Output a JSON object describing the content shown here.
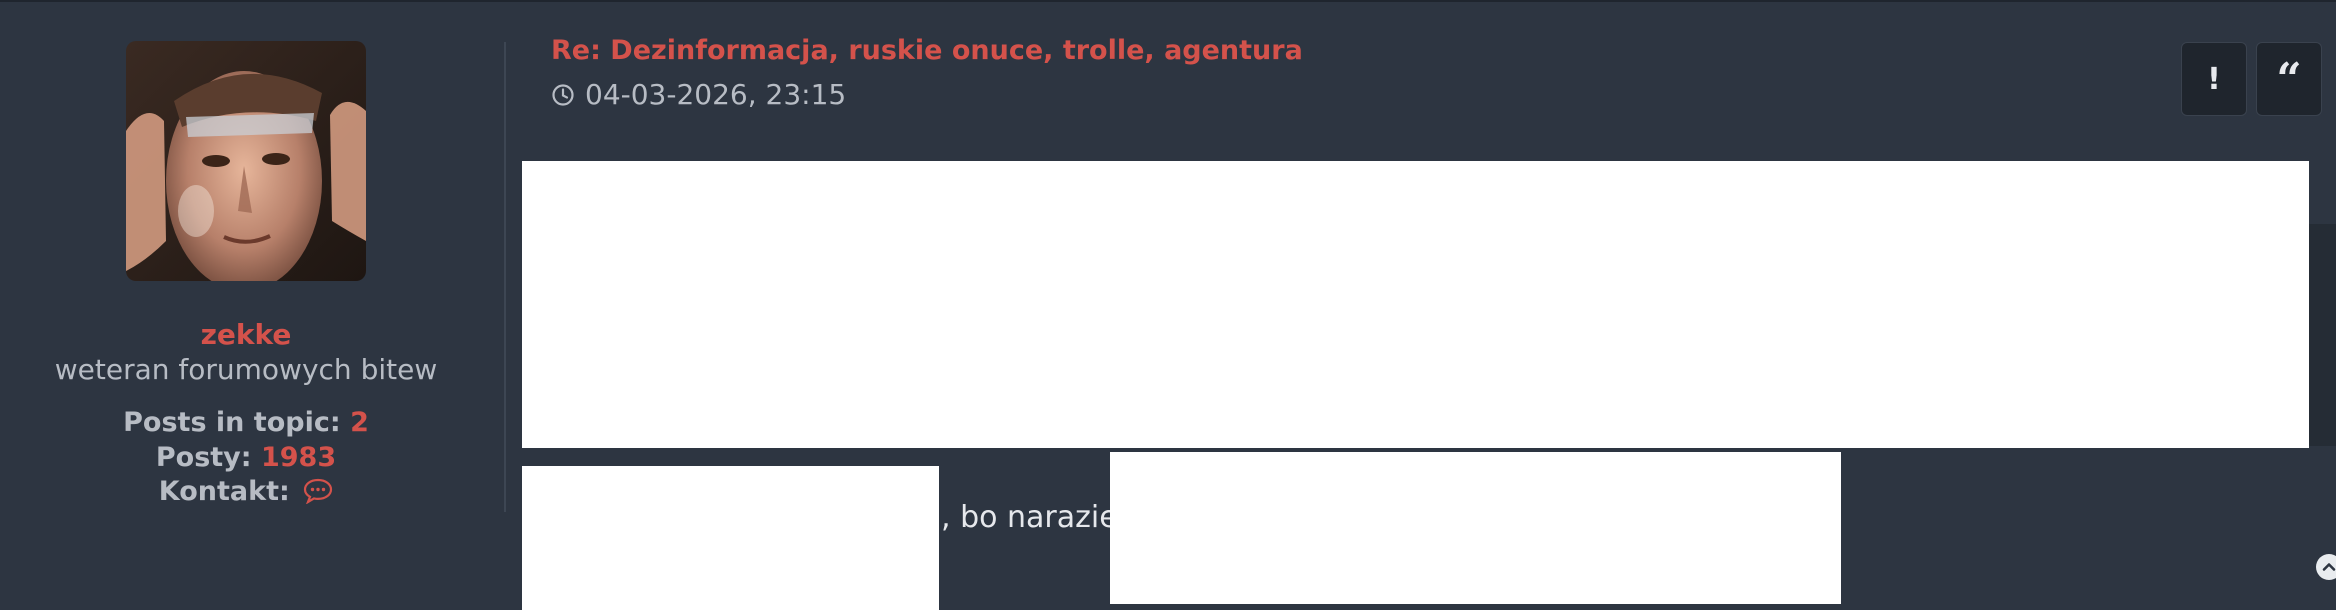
{
  "user": {
    "username": "zekke",
    "rank": "weteran forumowych bitew",
    "posts_in_topic_label": "Posts in topic:",
    "posts_in_topic": "2",
    "posts_label": "Posty:",
    "posts": "1983",
    "contact_label": "Kontakt:"
  },
  "post": {
    "title": "Re: Dezinformacja, ruskie onuce, trolle, agentura",
    "date": "04-03-2026, 23:15",
    "text_fragment": ", bo narazie"
  },
  "buttons": {
    "report_label": "!",
    "quote_label": "“"
  },
  "icons": {
    "clock": "clock-icon",
    "chat": "chat-bubble-icon",
    "scroll_top": "chevron-up-icon"
  },
  "colors": {
    "background": "#2d3541",
    "accent": "#d4524b",
    "muted_text": "#b7bcc4",
    "button_bg": "#1f252d"
  }
}
